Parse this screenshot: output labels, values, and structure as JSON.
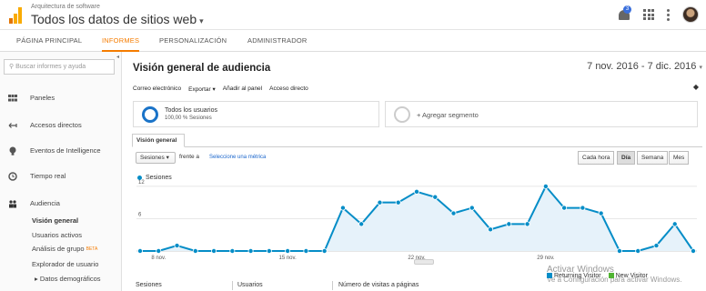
{
  "header": {
    "account_subtitle": "Arquitectura de software",
    "account_title": "Todos los datos de sitios web",
    "notifications_count": "3"
  },
  "nav": {
    "tabs": [
      "PÁGINA PRINCIPAL",
      "INFORMES",
      "PERSONALIZACIÓN",
      "ADMINISTRADOR"
    ],
    "active_tab": "INFORMES"
  },
  "sidebar": {
    "search_placeholder": "Buscar informes y ayuda",
    "items": [
      {
        "label": "Paneles",
        "icon": "grid-icon"
      },
      {
        "label": "Accesos directos",
        "icon": "shortcut-arrow-icon"
      },
      {
        "label": "Eventos de Intelligence",
        "icon": "lightbulb-icon"
      },
      {
        "label": "Tiempo real",
        "icon": "clock-icon"
      },
      {
        "label": "Audiencia",
        "icon": "people-icon"
      }
    ],
    "sub_items": [
      "Visión general",
      "Usuarios activos",
      "Análisis de grupo",
      "Explorador de usuario",
      "▸ Datos demográficos"
    ],
    "beta_label": "BETA"
  },
  "main": {
    "title": "Visión general de audiencia",
    "date_range": "7 nov. 2016 - 7 dic. 2016",
    "actions": [
      "Correo electrónico",
      "Exportar ▾",
      "Añadir al panel",
      "Acceso directo"
    ],
    "segments": {
      "active_name": "Todos los usuarios",
      "active_pct": "100,00 % Sesiones",
      "add_label": "+ Agregar segmento"
    },
    "view_tab": "Visión general",
    "metric_select": "Sesiones",
    "versus_label": "frente a",
    "versus_link": "Seleccione una métrica",
    "periods": [
      "Cada hora",
      "Día",
      "Semana",
      "Mes"
    ],
    "active_period": "Día",
    "watermark_title": "Activar Windows",
    "watermark_text": "Ve a Configuración para activar Windows.",
    "pie_legend": [
      "Returning Visitor",
      "New Visitor"
    ],
    "table_headers": [
      "Sesiones",
      "Usuarios",
      "Número de visitas a páginas"
    ]
  },
  "colors": {
    "accent": "#f57c00",
    "series": "#058dc7",
    "returning": "#058dc7",
    "new_visitor": "#50b432"
  },
  "chart_data": {
    "type": "area",
    "series": [
      {
        "name": "Sesiones",
        "values": [
          0,
          0,
          1,
          0,
          0,
          0,
          0,
          0,
          0,
          0,
          0,
          8,
          5,
          9,
          9,
          11,
          10,
          7,
          8,
          4,
          5,
          5,
          12,
          8,
          8,
          7,
          0,
          0,
          1,
          5,
          0
        ]
      }
    ],
    "x": [
      "7 nov.",
      "8 nov.",
      "9 nov.",
      "10 nov.",
      "11 nov.",
      "12 nov.",
      "13 nov.",
      "14 nov.",
      "15 nov.",
      "16 nov.",
      "17 nov.",
      "18 nov.",
      "19 nov.",
      "20 nov.",
      "21 nov.",
      "22 nov.",
      "23 nov.",
      "24 nov.",
      "25 nov.",
      "26 nov.",
      "27 nov.",
      "28 nov.",
      "29 nov.",
      "30 nov.",
      "1 dic.",
      "2 dic.",
      "3 dic.",
      "4 dic.",
      "5 dic.",
      "6 dic.",
      "7 dic."
    ],
    "x_tick_labels": [
      "8 nov.",
      "15 nov.",
      "22 nov.",
      "29 nov."
    ],
    "y_tick_labels": [
      "12",
      "6"
    ],
    "ylim": [
      0,
      13.5
    ],
    "legend": "top-left",
    "grid": true
  }
}
